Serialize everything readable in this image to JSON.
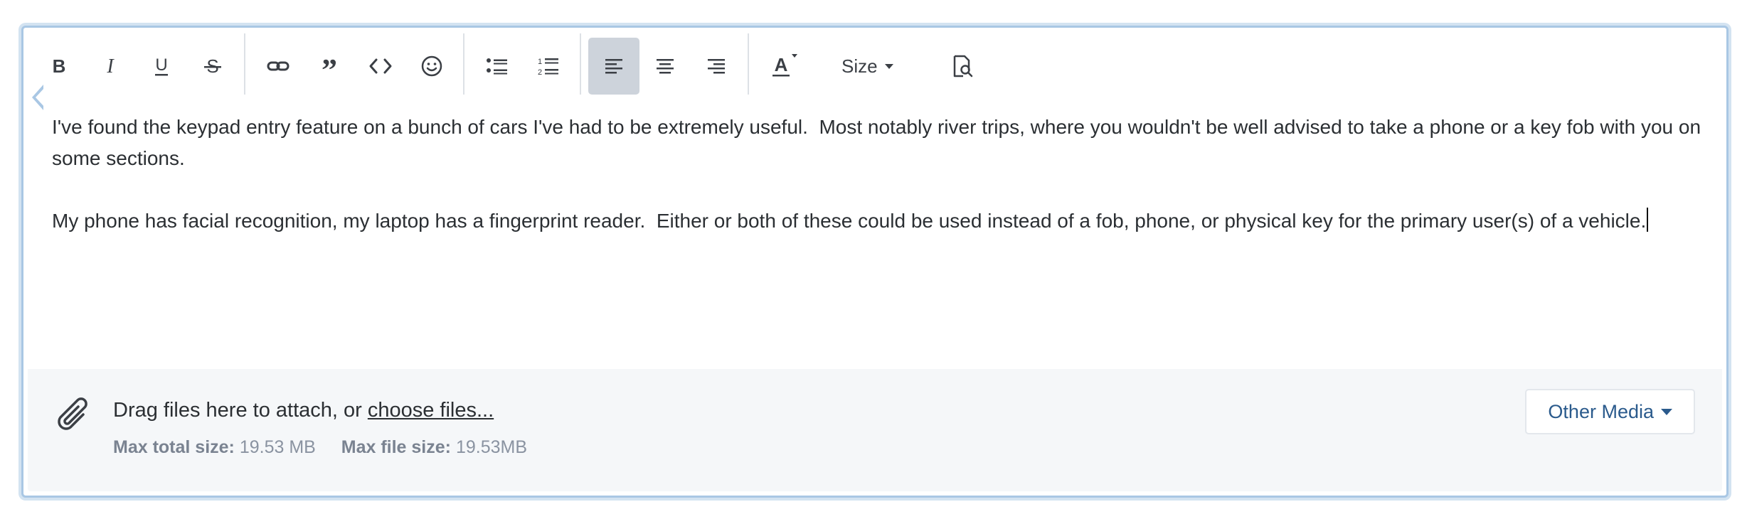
{
  "toolbar": {
    "buttons": [
      {
        "name": "bold",
        "icon": "bold-icon"
      },
      {
        "name": "italic",
        "icon": "italic-icon"
      },
      {
        "name": "underline",
        "icon": "underline-icon"
      },
      {
        "name": "strikethrough",
        "icon": "strikethrough-icon"
      },
      {
        "name": "link",
        "icon": "link-icon"
      },
      {
        "name": "quote",
        "icon": "quote-icon"
      },
      {
        "name": "code",
        "icon": "code-icon"
      },
      {
        "name": "emoji",
        "icon": "smiley-icon"
      },
      {
        "name": "bulleted-list",
        "icon": "bullet-list-icon"
      },
      {
        "name": "numbered-list",
        "icon": "numbered-list-icon"
      },
      {
        "name": "align-left",
        "icon": "align-left-icon",
        "active": true
      },
      {
        "name": "align-center",
        "icon": "align-center-icon"
      },
      {
        "name": "align-right",
        "icon": "align-right-icon"
      },
      {
        "name": "text-color",
        "icon": "text-color-icon"
      },
      {
        "name": "preview",
        "icon": "preview-icon"
      }
    ],
    "size_label": "Size"
  },
  "content": {
    "paragraphs": [
      "I've found the keypad entry feature on a bunch of cars I've had to be extremely useful.  Most notably river trips, where you wouldn't be well advised to take a phone or a key fob with you on some sections.",
      "My phone has facial recognition, my laptop has a fingerprint reader.  Either or both of these could be used instead of a fob, phone, or physical key for the primary user(s) of a vehicle."
    ]
  },
  "attachments": {
    "prompt_text": "Drag files here to attach, or ",
    "choose_link": "choose files...",
    "max_total_label": "Max total size:",
    "max_total_value": "19.53 MB",
    "max_file_label": "Max file size:",
    "max_file_value": "19.53MB",
    "other_media_label": "Other Media"
  },
  "colors": {
    "focus_border": "#a9c7e4",
    "active_button": "#cdd3db",
    "link_blue": "#2a5a8c"
  }
}
